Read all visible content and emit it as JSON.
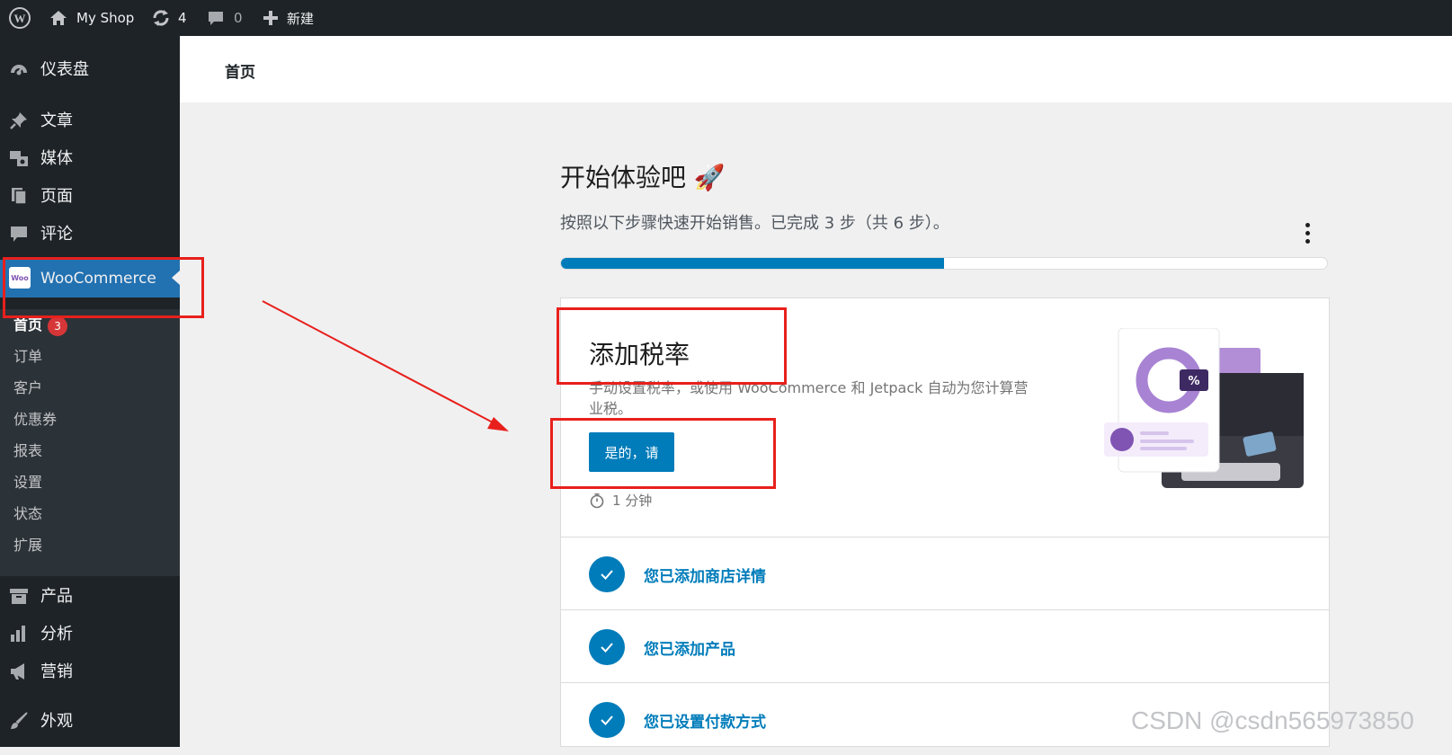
{
  "adminbar": {
    "site_name": "My Shop",
    "updates_count": "4",
    "comments_count": "0",
    "new_label": "新建"
  },
  "sidebar": {
    "items_top": [
      {
        "label": "仪表盘",
        "icon": "dashboard-icon"
      },
      {
        "label": "文章",
        "icon": "pin-icon"
      },
      {
        "label": "媒体",
        "icon": "media-icon"
      },
      {
        "label": "页面",
        "icon": "page-icon"
      },
      {
        "label": "评论",
        "icon": "comment-icon"
      }
    ],
    "woocommerce": {
      "label": "WooCommerce",
      "badge": "Woo"
    },
    "submenu": [
      {
        "label": "首页",
        "count": "3"
      },
      {
        "label": "订单"
      },
      {
        "label": "客户"
      },
      {
        "label": "优惠券"
      },
      {
        "label": "报表"
      },
      {
        "label": "设置"
      },
      {
        "label": "状态"
      },
      {
        "label": "扩展"
      }
    ],
    "items_bottom": [
      {
        "label": "产品",
        "icon": "archive-icon"
      },
      {
        "label": "分析",
        "icon": "chart-bar-icon"
      },
      {
        "label": "营销",
        "icon": "megaphone-icon"
      },
      {
        "label": "外观",
        "icon": "brush-icon"
      }
    ]
  },
  "header": {
    "title": "首页"
  },
  "intro": {
    "title": "开始体验吧 🚀",
    "subtitle": "按照以下步骤快速开始销售。已完成 3 步（共 6 步）。",
    "progress_fraction": 0.5
  },
  "task": {
    "title": "添加税率",
    "description": "手动设置税率，或使用 WooCommerce 和 Jetpack 自动为您计算营业税。",
    "button_label": "是的，请",
    "time": "1 分钟",
    "illustration_badge": "%"
  },
  "completed": [
    {
      "label": "您已添加商店详情"
    },
    {
      "label": "您已添加产品"
    },
    {
      "label": "您已设置付款方式"
    }
  ],
  "watermark": "CSDN @csdn565973850",
  "colors": {
    "accent": "#007cba",
    "annotation_red": "#e8201c",
    "sidebar": "#1d2327"
  }
}
